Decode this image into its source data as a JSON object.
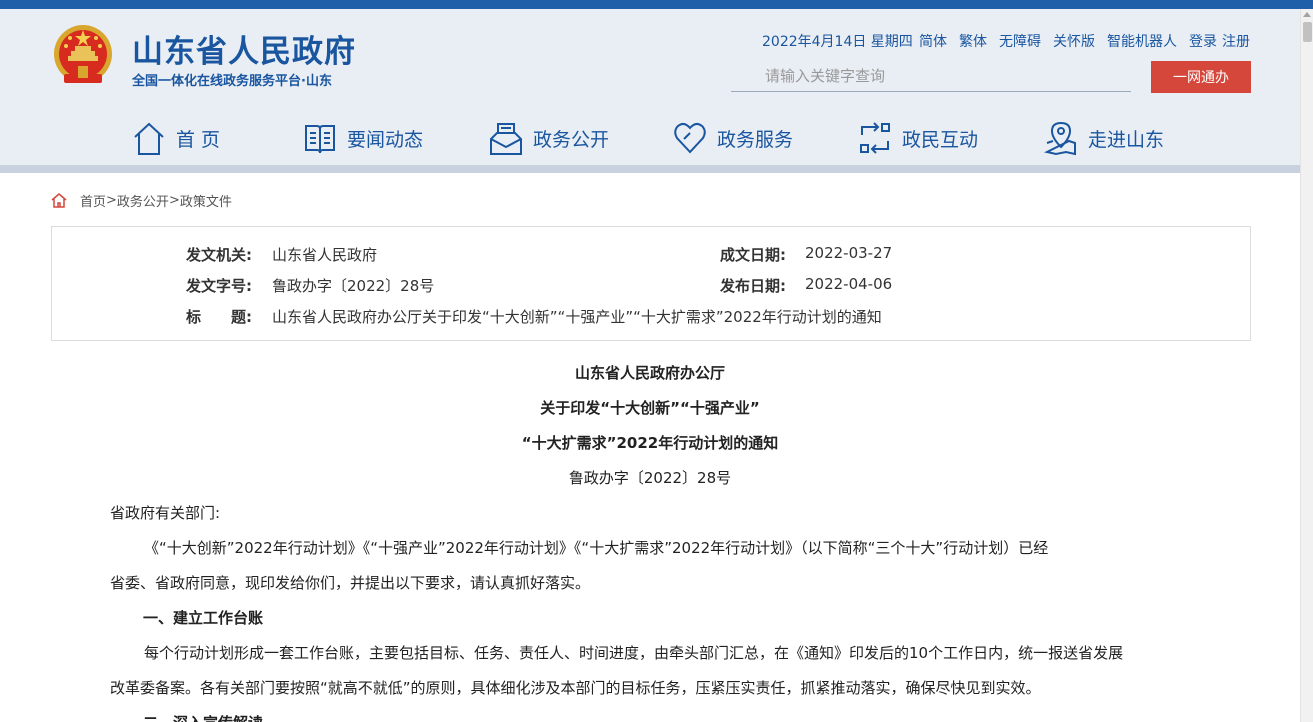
{
  "header": {
    "site_title": "山东省人民政府",
    "site_subtitle": "全国一体化在线政务服务平台·山东",
    "date": "2022年4月14日 星期四",
    "links": [
      "简体",
      "繁体",
      "无障碍",
      "关怀版",
      "智能机器人",
      "登录",
      "注册"
    ],
    "search_placeholder": "请输入关键字查询",
    "yiwang_button": "一网通办"
  },
  "nav": {
    "items": [
      {
        "label": "首 页",
        "icon": "home-icon"
      },
      {
        "label": "要闻动态",
        "icon": "book-icon"
      },
      {
        "label": "政务公开",
        "icon": "inbox-icon"
      },
      {
        "label": "政务服务",
        "icon": "heart-icon"
      },
      {
        "label": "政民互动",
        "icon": "exchange-icon"
      },
      {
        "label": "走进山东",
        "icon": "map-pin-icon"
      }
    ]
  },
  "breadcrumb": {
    "items": [
      "首页",
      "政务公开",
      "政策文件"
    ],
    "separator": ">"
  },
  "meta": {
    "issuer_label": "发文机关:",
    "issuer": "山东省人民政府",
    "doc_no_label": "发文字号:",
    "doc_no": "鲁政办字〔2022〕28号",
    "title_label": "标　　题:",
    "title": "山东省人民政府办公厅关于印发“十大创新”“十强产业”“十大扩需求”2022年行动计划的通知",
    "written_date_label": "成文日期:",
    "written_date": "2022-03-27",
    "publish_date_label": "发布日期:",
    "publish_date": "2022-04-06"
  },
  "document": {
    "heading_line1": "山东省人民政府办公厅",
    "heading_line2": "关于印发“十大创新”“十强产业”",
    "heading_line3": "“十大扩需求”2022年行动计划的通知",
    "doc_number": "鲁政办字〔2022〕28号",
    "salutation": "省政府有关部门:",
    "para1_line1": "《“十大创新”2022年行动计划》《“十强产业”2022年行动计划》《“十大扩需求”2022年行动计划》（以下简称“三个十大”行动计划）已经",
    "para1_line2": "省委、省政府同意，现印发给你们，并提出以下要求，请认真抓好落实。",
    "section1_title": "一、建立工作台账",
    "para2_line1": "每个行动计划形成一套工作台账，主要包括目标、任务、责任人、时间进度，由牵头部门汇总，在《通知》印发后的10个工作日内，统一报送省发展",
    "para2_line2": "改革委备案。各有关部门要按照“就高不就低”的原则，具体细化涉及本部门的目标任务，压紧压实责任，抓紧推动落实，确保尽快见到实效。",
    "section2_title": "二、深入宣传解读"
  },
  "colors": {
    "brand_blue": "#1a56a0",
    "header_bg": "#e9eef5",
    "button_red": "#d5473b"
  }
}
